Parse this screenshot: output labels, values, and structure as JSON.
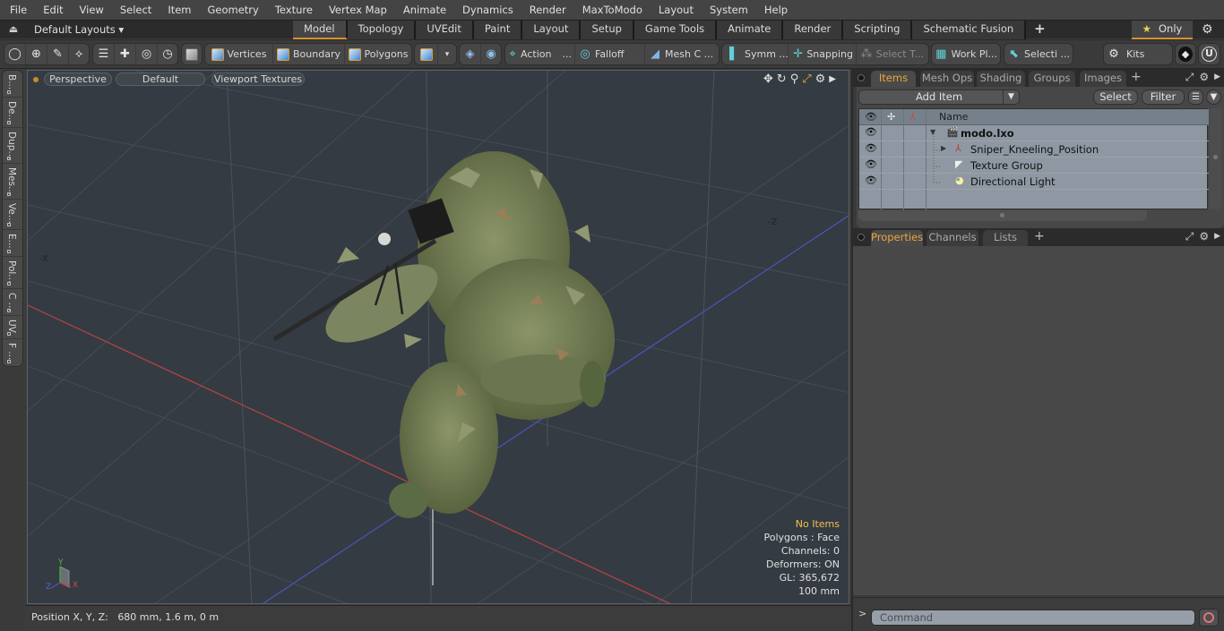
{
  "menubar": {
    "items": [
      "File",
      "Edit",
      "View",
      "Select",
      "Item",
      "Geometry",
      "Texture",
      "Vertex Map",
      "Animate",
      "Dynamics",
      "Render",
      "MaxToModo",
      "Layout",
      "System",
      "Help"
    ]
  },
  "layoutbar": {
    "layouts_label": "Default Layouts",
    "tabs": [
      "Model",
      "Topology",
      "UVEdit",
      "Paint",
      "Layout",
      "Setup",
      "Game Tools",
      "Animate",
      "Render",
      "Scripting",
      "Schematic Fusion"
    ],
    "active_tab": "Model",
    "add_tab": "+",
    "only_label": "Only"
  },
  "toolbar": {
    "vertices": "Vertices",
    "boundary": "Boundary",
    "polygons": "Polygons",
    "action": "Action",
    "action_more": "...",
    "falloff": "Falloff",
    "mesh_c": "Mesh C ...",
    "symm": "Symm ...",
    "snapping": "Snapping",
    "select_t": "Select T...",
    "work_pl": "Work Pl...",
    "selecti": "Selecti ...",
    "kits": "Kits"
  },
  "left_palette": {
    "items": [
      "B...",
      "De...",
      "Dup...",
      "Mes...",
      "Ve...",
      "E...",
      "Pol...",
      "C ...",
      "UV",
      "F ..."
    ]
  },
  "viewport": {
    "view_mode": "Perspective",
    "shading": "Default",
    "textures": "Viewport Textures",
    "axis_labels": {
      "neg_x": "-X",
      "neg_z": "-Z"
    },
    "hud": {
      "selection": "No Items",
      "polygons": "Polygons : Face",
      "channels": "Channels: 0",
      "deformers": "Deformers: ON",
      "gl": "GL: 365,672",
      "scale": "100 mm"
    },
    "gizmo": {
      "x": "X",
      "y": "Y",
      "z": "Z"
    }
  },
  "statusbar": {
    "position_label": "Position X, Y, Z:",
    "position_value": "680 mm, 1.6 m, 0 m"
  },
  "items_panel": {
    "tabs": [
      "Items",
      "Mesh Ops",
      "Shading",
      "Groups",
      "Images"
    ],
    "active_tab": "Items",
    "add_item": "Add Item",
    "select": "Select",
    "filter": "Filter",
    "column_name": "Name",
    "tree": [
      {
        "label": "modo.lxo",
        "level": 0,
        "icon": "scene-icon",
        "expanded": true,
        "bold": true
      },
      {
        "label": "Sniper_Kneeling_Position",
        "level": 1,
        "icon": "locator-icon",
        "expandable": true
      },
      {
        "label": "Texture Group",
        "level": 1,
        "icon": "texture-group-icon"
      },
      {
        "label": "Directional Light",
        "level": 1,
        "icon": "light-icon"
      }
    ]
  },
  "properties_panel": {
    "tabs": [
      "Properties",
      "Channels",
      "Lists"
    ],
    "active_tab": "Properties"
  },
  "command": {
    "prompt": ">",
    "placeholder": "Command"
  },
  "colors": {
    "accent": "#d9902e",
    "active_tab_text": "#eaa53a",
    "hud_highlight": "#f0c050",
    "x_axis": "#c84040",
    "z_axis": "#4a55c8",
    "y_axis": "#40b040"
  }
}
